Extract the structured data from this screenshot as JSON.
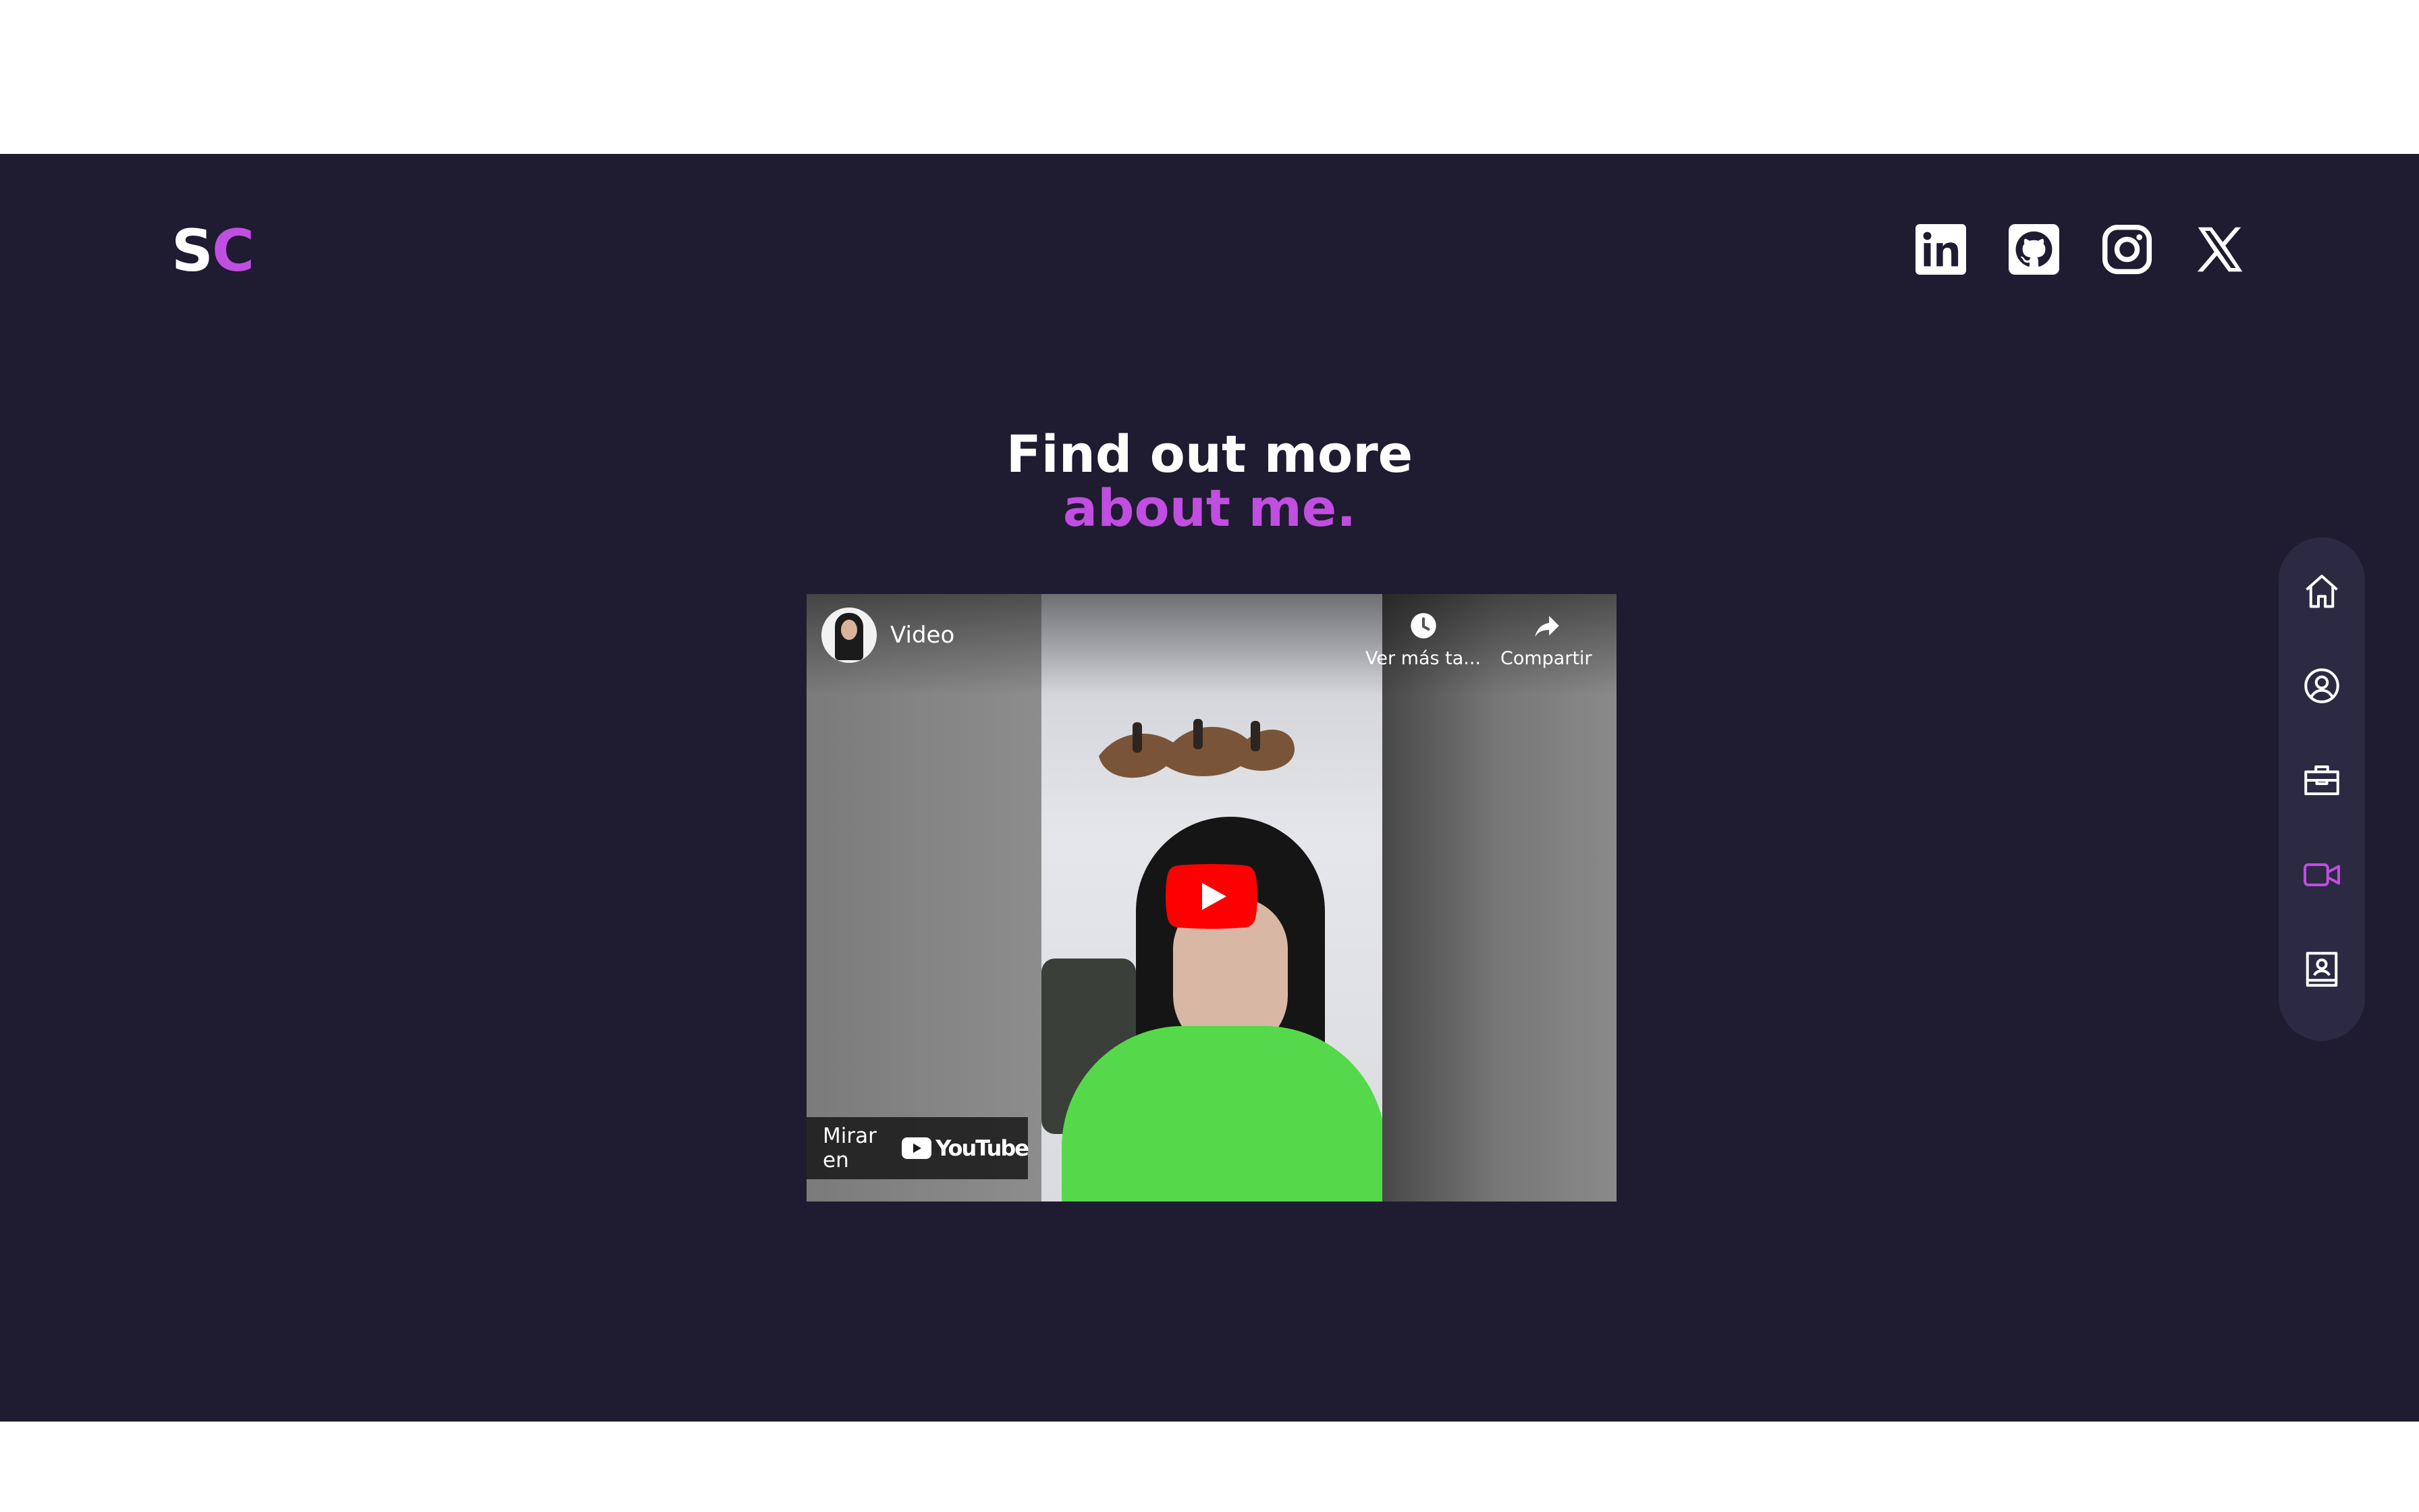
{
  "brand": {
    "logo_s": "S",
    "logo_c": "C",
    "accent_color": "#c04ee0",
    "background_color": "#1f1b31"
  },
  "socials": [
    {
      "name": "LinkedIn",
      "icon": "linkedin-icon"
    },
    {
      "name": "GitHub",
      "icon": "github-icon"
    },
    {
      "name": "Instagram",
      "icon": "instagram-icon"
    },
    {
      "name": "X",
      "icon": "x-icon"
    }
  ],
  "heading": {
    "line1": "Find out more",
    "line2": "about me."
  },
  "video": {
    "title": "Video",
    "watch_later_label": "Ver más ta...",
    "share_label": "Compartir",
    "watch_on_label": "Mirar en",
    "youtube_label": "YouTube"
  },
  "sidenav": {
    "items": [
      {
        "icon": "home-icon",
        "active": false
      },
      {
        "icon": "user-circle-icon",
        "active": false
      },
      {
        "icon": "briefcase-icon",
        "active": false
      },
      {
        "icon": "video-camera-icon",
        "active": true
      },
      {
        "icon": "contact-book-icon",
        "active": false
      }
    ]
  }
}
